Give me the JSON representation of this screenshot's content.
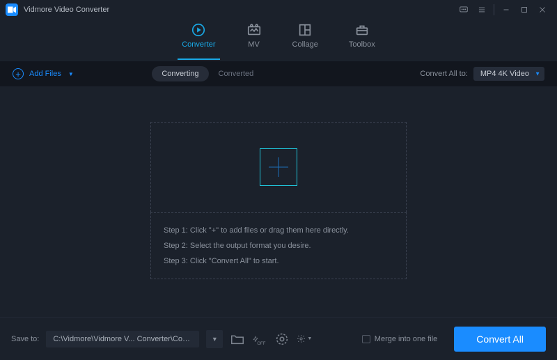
{
  "title": "Vidmore Video Converter",
  "icons": {
    "feedback": "feedback-icon",
    "menu": "menu-icon",
    "minimize": "minimize-icon",
    "maximize": "maximize-icon",
    "close": "close-icon"
  },
  "nav": {
    "converter": "Converter",
    "mv": "MV",
    "collage": "Collage",
    "toolbox": "Toolbox"
  },
  "subbar": {
    "add_files": "Add Files",
    "converting": "Converting",
    "converted": "Converted",
    "convert_all_to": "Convert All to:",
    "format_selected": "MP4 4K Video"
  },
  "drop": {
    "step1": "Step 1: Click \"+\" to add files or drag them here directly.",
    "step2": "Step 2: Select the output format you desire.",
    "step3": "Step 3: Click \"Convert All\" to start."
  },
  "footer": {
    "save_to": "Save to:",
    "path": "C:\\Vidmore\\Vidmore V... Converter\\Converted",
    "merge": "Merge into one file",
    "convert_all": "Convert All"
  }
}
